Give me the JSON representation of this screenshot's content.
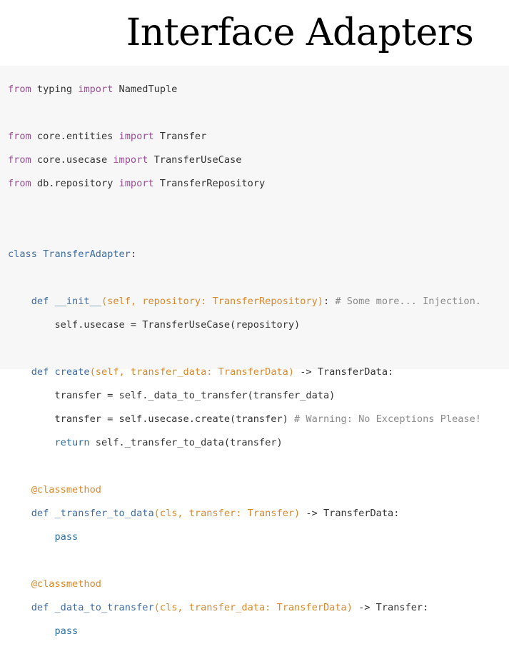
{
  "title": "Interface Adapters",
  "code": {
    "line_import_typing": {
      "kw1": "from",
      "mod": " typing ",
      "kw2": "import",
      "name": " NamedTuple"
    },
    "line_import_entities": {
      "kw1": "from",
      "mod": " core.entities ",
      "kw2": "import",
      "name": " Transfer"
    },
    "line_import_usecase": {
      "kw1": "from",
      "mod": " core.usecase ",
      "kw2": "import",
      "name": " TransferUseCase"
    },
    "line_import_repo": {
      "kw1": "from",
      "mod": " db.repository ",
      "kw2": "import",
      "name": " TransferRepository"
    },
    "class_decl": {
      "kw": "class",
      "name": "TransferAdapter",
      "tail": ":"
    },
    "init_def": {
      "kw": "def",
      "name": "__init__",
      "params": "(self, repository: TransferRepository)",
      "tail": ": ",
      "comment": "# Some more... Injection."
    },
    "init_body": "self.usecase = TransferUseCase(repository)",
    "create_def": {
      "kw": "def",
      "name": "create",
      "params": "(self, transfer_data: TransferData)",
      "tail": " -> TransferData:"
    },
    "create_body1": "transfer = self._data_to_transfer(transfer_data)",
    "create_body2": {
      "code": "transfer = self.usecase.create(transfer) ",
      "comment": "# Warning: No Exceptions Please!"
    },
    "create_body3": {
      "kw": "return",
      "code": " self._transfer_to_data(transfer)"
    },
    "decorator1": "@classmethod",
    "t2d_def": {
      "kw": "def",
      "name": "_transfer_to_data",
      "params": "(cls, transfer: Transfer)",
      "tail": " -> TransferData:"
    },
    "pass1": "pass",
    "decorator2": "@classmethod",
    "d2t_def": {
      "kw": "def",
      "name": "_data_to_transfer",
      "params": "(cls, transfer_data: TransferData)",
      "tail": " -> Transfer:"
    },
    "pass2": "pass"
  }
}
